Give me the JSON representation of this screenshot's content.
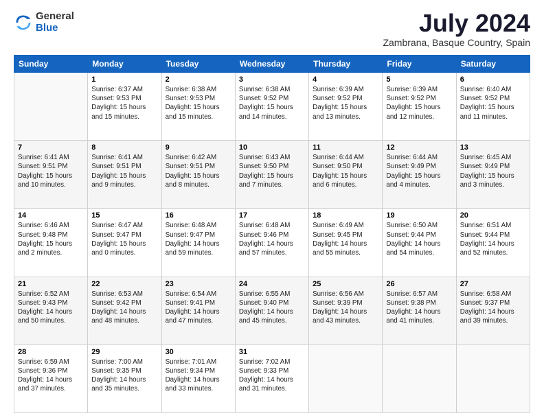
{
  "logo": {
    "general": "General",
    "blue": "Blue"
  },
  "header": {
    "title": "July 2024",
    "location": "Zambrana, Basque Country, Spain"
  },
  "calendar": {
    "days": [
      "Sunday",
      "Monday",
      "Tuesday",
      "Wednesday",
      "Thursday",
      "Friday",
      "Saturday"
    ]
  },
  "weeks": [
    [
      {
        "day": "",
        "info": ""
      },
      {
        "day": "1",
        "info": "Sunrise: 6:37 AM\nSunset: 9:53 PM\nDaylight: 15 hours\nand 15 minutes."
      },
      {
        "day": "2",
        "info": "Sunrise: 6:38 AM\nSunset: 9:53 PM\nDaylight: 15 hours\nand 15 minutes."
      },
      {
        "day": "3",
        "info": "Sunrise: 6:38 AM\nSunset: 9:52 PM\nDaylight: 15 hours\nand 14 minutes."
      },
      {
        "day": "4",
        "info": "Sunrise: 6:39 AM\nSunset: 9:52 PM\nDaylight: 15 hours\nand 13 minutes."
      },
      {
        "day": "5",
        "info": "Sunrise: 6:39 AM\nSunset: 9:52 PM\nDaylight: 15 hours\nand 12 minutes."
      },
      {
        "day": "6",
        "info": "Sunrise: 6:40 AM\nSunset: 9:52 PM\nDaylight: 15 hours\nand 11 minutes."
      }
    ],
    [
      {
        "day": "7",
        "info": "Sunrise: 6:41 AM\nSunset: 9:51 PM\nDaylight: 15 hours\nand 10 minutes."
      },
      {
        "day": "8",
        "info": "Sunrise: 6:41 AM\nSunset: 9:51 PM\nDaylight: 15 hours\nand 9 minutes."
      },
      {
        "day": "9",
        "info": "Sunrise: 6:42 AM\nSunset: 9:51 PM\nDaylight: 15 hours\nand 8 minutes."
      },
      {
        "day": "10",
        "info": "Sunrise: 6:43 AM\nSunset: 9:50 PM\nDaylight: 15 hours\nand 7 minutes."
      },
      {
        "day": "11",
        "info": "Sunrise: 6:44 AM\nSunset: 9:50 PM\nDaylight: 15 hours\nand 6 minutes."
      },
      {
        "day": "12",
        "info": "Sunrise: 6:44 AM\nSunset: 9:49 PM\nDaylight: 15 hours\nand 4 minutes."
      },
      {
        "day": "13",
        "info": "Sunrise: 6:45 AM\nSunset: 9:49 PM\nDaylight: 15 hours\nand 3 minutes."
      }
    ],
    [
      {
        "day": "14",
        "info": "Sunrise: 6:46 AM\nSunset: 9:48 PM\nDaylight: 15 hours\nand 2 minutes."
      },
      {
        "day": "15",
        "info": "Sunrise: 6:47 AM\nSunset: 9:47 PM\nDaylight: 15 hours\nand 0 minutes."
      },
      {
        "day": "16",
        "info": "Sunrise: 6:48 AM\nSunset: 9:47 PM\nDaylight: 14 hours\nand 59 minutes."
      },
      {
        "day": "17",
        "info": "Sunrise: 6:48 AM\nSunset: 9:46 PM\nDaylight: 14 hours\nand 57 minutes."
      },
      {
        "day": "18",
        "info": "Sunrise: 6:49 AM\nSunset: 9:45 PM\nDaylight: 14 hours\nand 55 minutes."
      },
      {
        "day": "19",
        "info": "Sunrise: 6:50 AM\nSunset: 9:44 PM\nDaylight: 14 hours\nand 54 minutes."
      },
      {
        "day": "20",
        "info": "Sunrise: 6:51 AM\nSunset: 9:44 PM\nDaylight: 14 hours\nand 52 minutes."
      }
    ],
    [
      {
        "day": "21",
        "info": "Sunrise: 6:52 AM\nSunset: 9:43 PM\nDaylight: 14 hours\nand 50 minutes."
      },
      {
        "day": "22",
        "info": "Sunrise: 6:53 AM\nSunset: 9:42 PM\nDaylight: 14 hours\nand 48 minutes."
      },
      {
        "day": "23",
        "info": "Sunrise: 6:54 AM\nSunset: 9:41 PM\nDaylight: 14 hours\nand 47 minutes."
      },
      {
        "day": "24",
        "info": "Sunrise: 6:55 AM\nSunset: 9:40 PM\nDaylight: 14 hours\nand 45 minutes."
      },
      {
        "day": "25",
        "info": "Sunrise: 6:56 AM\nSunset: 9:39 PM\nDaylight: 14 hours\nand 43 minutes."
      },
      {
        "day": "26",
        "info": "Sunrise: 6:57 AM\nSunset: 9:38 PM\nDaylight: 14 hours\nand 41 minutes."
      },
      {
        "day": "27",
        "info": "Sunrise: 6:58 AM\nSunset: 9:37 PM\nDaylight: 14 hours\nand 39 minutes."
      }
    ],
    [
      {
        "day": "28",
        "info": "Sunrise: 6:59 AM\nSunset: 9:36 PM\nDaylight: 14 hours\nand 37 minutes."
      },
      {
        "day": "29",
        "info": "Sunrise: 7:00 AM\nSunset: 9:35 PM\nDaylight: 14 hours\nand 35 minutes."
      },
      {
        "day": "30",
        "info": "Sunrise: 7:01 AM\nSunset: 9:34 PM\nDaylight: 14 hours\nand 33 minutes."
      },
      {
        "day": "31",
        "info": "Sunrise: 7:02 AM\nSunset: 9:33 PM\nDaylight: 14 hours\nand 31 minutes."
      },
      {
        "day": "",
        "info": ""
      },
      {
        "day": "",
        "info": ""
      },
      {
        "day": "",
        "info": ""
      }
    ]
  ]
}
